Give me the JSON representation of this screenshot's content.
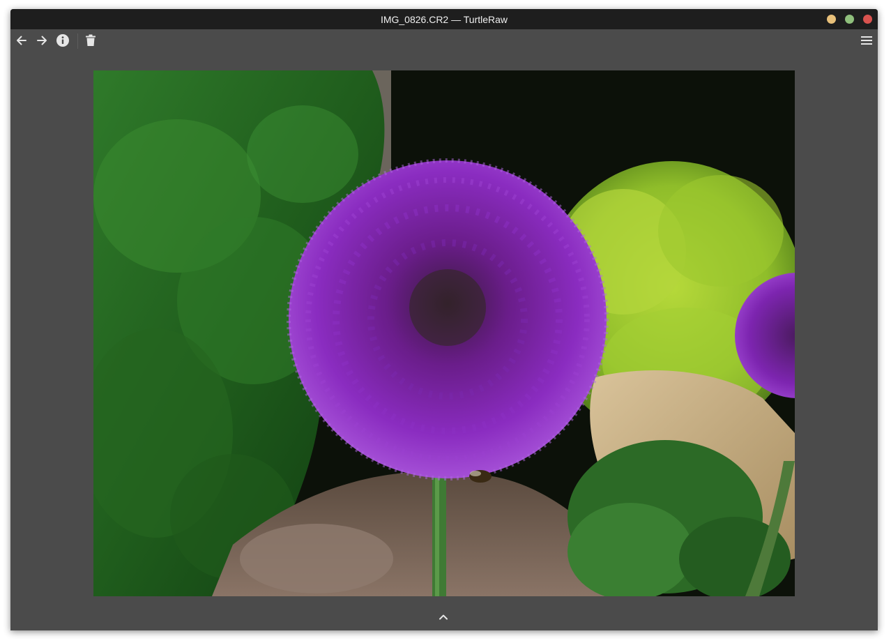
{
  "window": {
    "title": "IMG_0826.CR2 — TurtleRaw",
    "controls": {
      "minimize_color": "#e8c07a",
      "maximize_color": "#8fbf7c",
      "close_color": "#d9534f"
    }
  },
  "toolbar": {
    "back_icon": "arrow-left-icon",
    "forward_icon": "arrow-right-icon",
    "info_icon": "info-icon",
    "delete_icon": "trash-icon",
    "menu_icon": "hamburger-menu-icon"
  },
  "viewer": {
    "image_subject": "purple allium flower photo",
    "bottom_toggle_icon": "chevron-up-icon"
  },
  "colors": {
    "titlebar_bg": "#1e1e1e",
    "window_bg": "#4b4b4b",
    "icon_color": "#e6e6e6"
  }
}
